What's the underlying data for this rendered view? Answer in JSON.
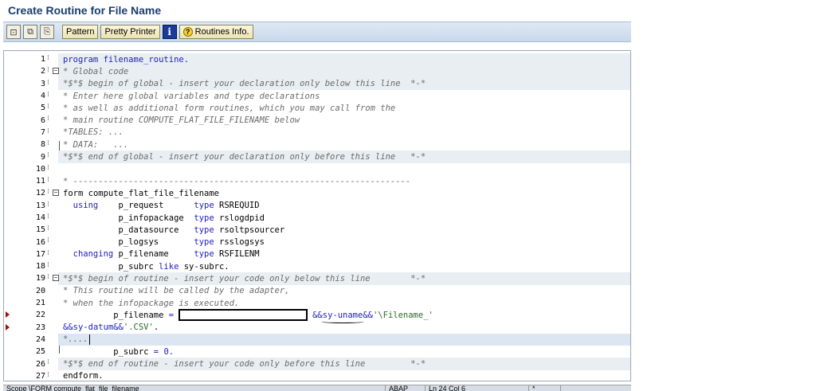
{
  "window": {
    "title": "Create Routine for File Name"
  },
  "toolbar": {
    "pattern_label": "Pattern",
    "pretty_printer_label": "Pretty Printer",
    "routines_info_label": "Routines Info.",
    "info_glyph": "i",
    "icons": [
      "display-object-icon",
      "copy-icon",
      "check-icon",
      "info-icon",
      "help-icon"
    ]
  },
  "editor": {
    "line_numbers": [
      "1",
      "2",
      "3",
      "4",
      "5",
      "6",
      "7",
      "8",
      "9",
      "10",
      "11",
      "12",
      "13",
      "14",
      "15",
      "16",
      "17",
      "18",
      "19",
      "20",
      "21",
      "22",
      "23",
      "24",
      "25",
      "26",
      "27"
    ],
    "lines": {
      "l1": "program filename_routine.",
      "l2": "* Global code",
      "l3": "*$*$ begin of global - insert your declaration only below this line  *-*",
      "l4": "* Enter here global variables and type declarations",
      "l5": "* as well as additional form routines, which you may call from the",
      "l6": "* main routine COMPUTE_FLAT_FILE_FILENAME below",
      "l7": "*TABLES: ...",
      "l8": "* DATA:   ...",
      "l9": "*$*$ end of global - insert your declaration only before this line   *-*",
      "l10": "",
      "l11": "* -------------------------------------------------------------------",
      "l12a": "form",
      "l12b": " compute_flat_file_filename",
      "l13a": "  using",
      "l13b": "    p_request      ",
      "l13c": "type",
      "l13d": " RSREQUID",
      "l14b": "           p_infopackage  ",
      "l14c": "type",
      "l14d": " rslogdpid",
      "l15b": "           p_datasource   ",
      "l15c": "type",
      "l15d": " rsoltpsourcer",
      "l16b": "           p_logsys       ",
      "l16c": "type",
      "l16d": " rsslogsys",
      "l17a": "  changing",
      "l17b": " p_filename     ",
      "l17c": "type",
      "l17d": " RSFILENM",
      "l18b": "           p_subrc ",
      "l18c": "like",
      "l18d": " sy-subrc.",
      "l19": "*$*$ begin of routine - insert your code only below this line        *-*",
      "l20": "* This routine will be called by the adapter,",
      "l21": "* when the infopackage is executed.",
      "l22a": "          p_filename ",
      "l22b": "=",
      "l22c": "&&",
      "l22d": "sy-uname",
      "l22e": "&&",
      "l22f": "'\\Filename_'",
      "l23a": "&&",
      "l23b": "sy-datum",
      "l23c": "&&",
      "l23d": "'.CSV'",
      "l23e": ".",
      "l24": "*....",
      "l25a": "          p_subrc ",
      "l25b": "= 0.",
      "l26": "*$*$ end of routine - insert your code only before this line         *-*",
      "l27": "endform."
    }
  },
  "status_bar": {
    "scope": "Scope \\FORM compute_flat_file_filename",
    "language": "ABAP",
    "position": "Ln 24 Col 6",
    "mode": "*"
  }
}
